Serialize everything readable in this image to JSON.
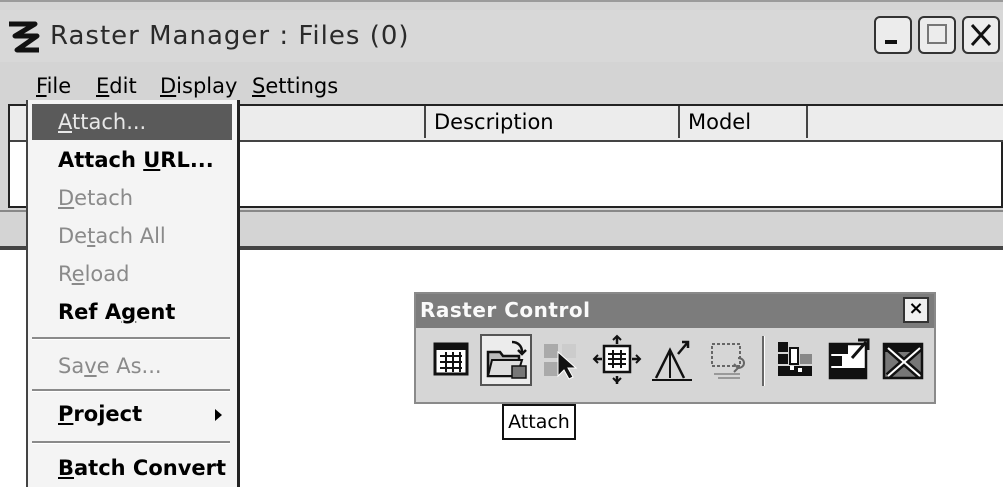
{
  "window": {
    "title": "Raster Manager : Files (0)",
    "controls": {
      "minimize_icon": "minimize-icon",
      "maximize_icon": "maximize-icon",
      "close_icon": "close-icon"
    }
  },
  "menubar": [
    {
      "pre": "",
      "u": "F",
      "post": "ile"
    },
    {
      "pre": "",
      "u": "E",
      "post": "dit"
    },
    {
      "pre": "",
      "u": "D",
      "post": "isplay"
    },
    {
      "pre": "",
      "u": "S",
      "post": "ettings"
    }
  ],
  "table": {
    "columns": [
      "Description",
      "Model"
    ]
  },
  "file_menu": [
    {
      "pre": "",
      "u": "A",
      "post": "ttach...",
      "state": "selected"
    },
    {
      "pre": "Attach ",
      "u": "U",
      "post": "RL...",
      "state": "enabled"
    },
    {
      "pre": "",
      "u": "D",
      "post": "etach",
      "state": "disabled"
    },
    {
      "pre": "De",
      "u": "t",
      "post": "ach All",
      "state": "disabled"
    },
    {
      "pre": "R",
      "u": "e",
      "post": "load",
      "state": "disabled"
    },
    {
      "pre": "Ref A",
      "u": "g",
      "post": "ent",
      "state": "enabled"
    },
    {
      "pre": "Sa",
      "u": "v",
      "post": "e As...",
      "state": "disabled"
    },
    {
      "pre": "",
      "u": "P",
      "post": "roject",
      "state": "enabled",
      "submenu": true
    },
    {
      "pre": "",
      "u": "B",
      "post": "atch Convert",
      "state": "enabled"
    }
  ],
  "raster_control": {
    "title": "Raster Control",
    "close_label": "×",
    "tools": [
      {
        "icon": "raster-manager-icon"
      },
      {
        "icon": "attach-raster-icon",
        "pressed": true
      },
      {
        "icon": "select-raster-icon"
      },
      {
        "icon": "move-raster-icon"
      },
      {
        "icon": "warp-raster-icon"
      },
      {
        "icon": "clip-raster-icon"
      },
      {
        "icon": "raster-layer-icon"
      },
      {
        "icon": "raster-export-icon"
      },
      {
        "icon": "raster-delete-icon"
      }
    ],
    "tooltip": "Attach"
  }
}
